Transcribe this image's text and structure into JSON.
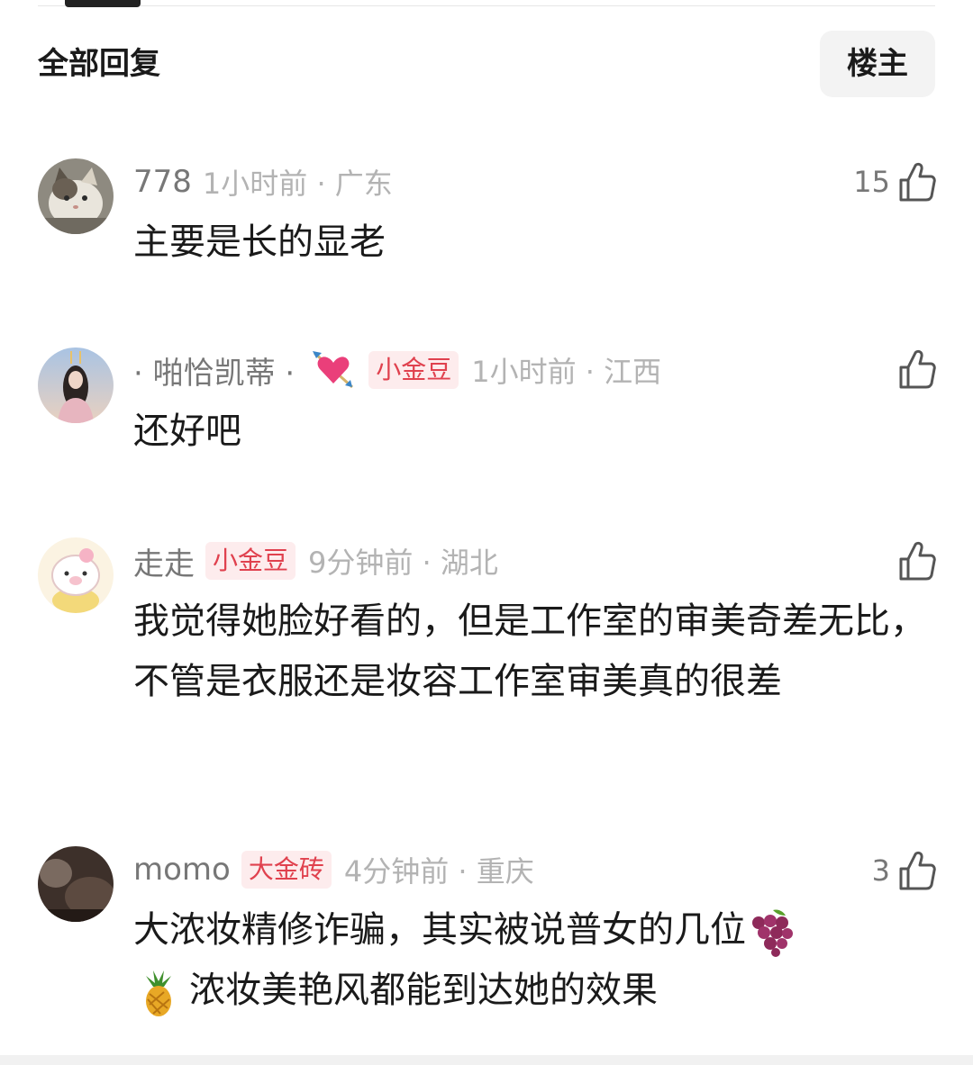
{
  "header": {
    "title": "全部回复",
    "filter_label": "楼主"
  },
  "comments": [
    {
      "username": "778",
      "time_location": "1小时前 · 广东",
      "content": "主要是长的显老",
      "likes": "15",
      "avatar_icon": "cat-avatar"
    },
    {
      "username": "· 啪恰凯蒂 ·",
      "sticker_icon": "heart-arrow-icon",
      "badge": "小金豆",
      "time_location": "1小时前 · 江西",
      "content": "还好吧",
      "avatar_icon": "girl-avatar"
    },
    {
      "username": "走走",
      "badge": "小金豆",
      "time_location": "9分钟前 · 湖北",
      "content": "我觉得她脸好看的，但是工作室的审美奇差无比，不管是衣服还是妆容工作室审美真的很差",
      "avatar_icon": "piggy-avatar"
    },
    {
      "username": "momo",
      "badge": "大金砖",
      "time_location": "4分钟前 · 重庆",
      "content_part1": "大浓妆精修诈骗，其实被说普女的几位",
      "content_part2": "浓妆美艳风都能到达她的效果",
      "likes": "3",
      "avatar_icon": "dark-avatar",
      "emoji_icons": [
        "grapes-icon",
        "pineapple-icon"
      ]
    }
  ],
  "colors": {
    "badge_text": "#e0414e",
    "badge_bg": "#fdeced",
    "meta_gray": "#b3b3b3"
  }
}
